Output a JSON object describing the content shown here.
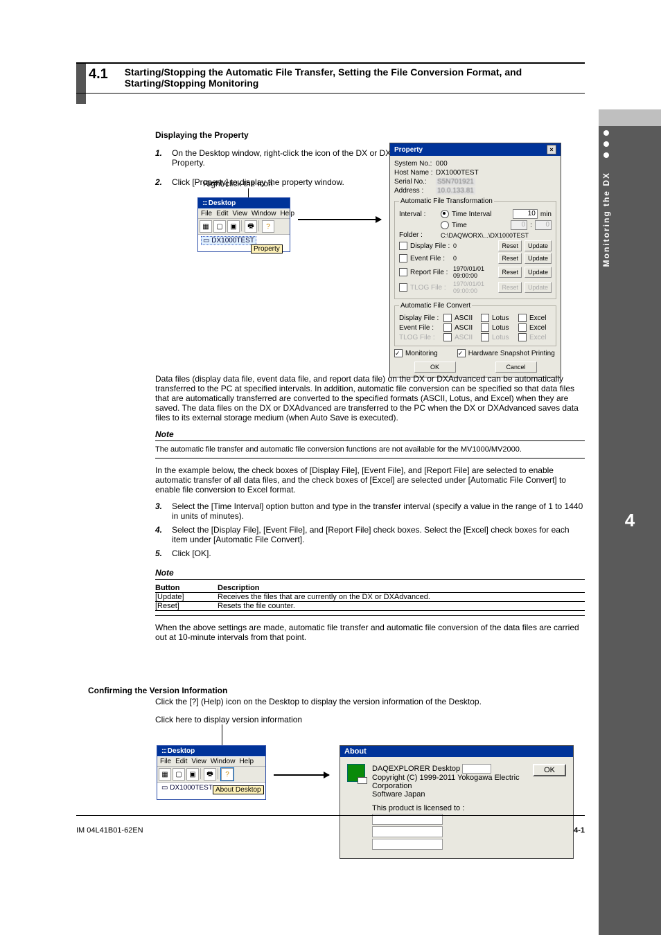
{
  "rightTab": {
    "num": "4",
    "label": "Monitoring the DX"
  },
  "section": {
    "number": "4.1",
    "title": "Starting/Stopping the Automatic File Transfer, Setting the File Conversion Format, and Starting/Stopping Monitoring"
  },
  "subsection": {
    "title": "Displaying the Property"
  },
  "steps": {
    "s1": "On the Desktop window, right-click the icon of the DX or DXAdvanced you wish to monitor to display the Property.",
    "s2": "Click [Property] to display the property window."
  },
  "callouts": {
    "rightclick": "Right-click the icon",
    "help": "Click here to display version information"
  },
  "desktop": {
    "title": "Desktop",
    "menus": [
      "File",
      "Edit",
      "View",
      "Window",
      "Help"
    ],
    "device": "DX1000TEST",
    "tooltip_prop": "Property",
    "tooltip_about": "About Desktop"
  },
  "property": {
    "title": "Property",
    "rows": {
      "systemno": {
        "label": "System No.:",
        "value": "000"
      },
      "hostname": {
        "label": "Host Name :",
        "value": "DX1000TEST"
      },
      "serial": {
        "label": "Serial No.:",
        "value": "S5N701921"
      },
      "address": {
        "label": "Address :",
        "value": "10.0.133.81"
      }
    },
    "aft": {
      "legend": "Automatic File Transformation",
      "intervalLabel": "Interval :",
      "opt_time_interval": "Time Interval",
      "opt_time": "Time",
      "time_interval_value": "10",
      "time_interval_unit": "min",
      "time_h": "0",
      "time_m": "0",
      "folderLabel": "Folder :",
      "folderVal": "C:\\DAQWORX\\...\\DX1000TEST",
      "filerows": [
        {
          "label": "Display File :",
          "value": "0",
          "reset": "Reset",
          "update": "Update",
          "en": true
        },
        {
          "label": "Event File :",
          "value": "0",
          "reset": "Reset",
          "update": "Update",
          "en": true
        },
        {
          "label": "Report File :",
          "value": "1970/01/01 09:00:00",
          "reset": "Reset",
          "update": "Update",
          "en": true
        },
        {
          "label": "TLOG File :",
          "value": "1970/01/01 09:00:00",
          "reset": "Reset",
          "update": "Update",
          "en": false
        }
      ]
    },
    "afc": {
      "legend": "Automatic File Convert",
      "rows": [
        {
          "label": "Display File :",
          "en": true
        },
        {
          "label": "Event File :",
          "en": true
        },
        {
          "label": "TLOG File :",
          "en": false
        }
      ],
      "fmt": {
        "ascii": "ASCII",
        "lotus": "Lotus",
        "excel": "Excel"
      }
    },
    "monitoring": "Monitoring",
    "hwprint": "Hardware Snapshot Printing",
    "ok": "OK",
    "cancel": "Cancel"
  },
  "explain": {
    "para1": "Data files (display data file, event data file, and report data file) on the DX or DXAdvanced can be automatically transferred to the PC at specified intervals. In addition, automatic file conversion can be specified so that data files that are automatically transferred are converted to the specified formats (ASCII, Lotus, and Excel) when they are saved. The data files on the DX or DXAdvanced are transferred to the PC when the DX or DXAdvanced saves data files to its external storage medium (when Auto Save is executed).",
    "notelabel": "Note",
    "note1": "The automatic file transfer and automatic file conversion functions are not available for the MV1000/MV2000.",
    "intro2": "In the example below, the check boxes of [Display File], [Event File], and [Report File] are selected to enable automatic transfer of all data files, and the check boxes of [Excel] are selected under [Automatic File Convert] to enable file conversion to Excel format.",
    "st3": "Select the [Time Interval] option button and type in the transfer interval (specify a value in the range of 1 to 1440 in units of minutes).",
    "st4": "Select the [Display File], [Event File], and [Report File] check boxes. Select the [Excel] check boxes for each item under [Automatic File Convert].",
    "st5": "Click [OK].",
    "notelabel2": "Note",
    "table": {
      "head": [
        "Button",
        "Description"
      ],
      "row_update": [
        "[Update]",
        "Receives the files that are currently on the DX or DXAdvanced."
      ],
      "row_reset": [
        "[Reset]",
        "Resets the file counter."
      ]
    },
    "after": "When the above settings are made, automatic file transfer and automatic file conversion of the data files are carried out at 10-minute intervals from that point."
  },
  "version": {
    "heading": "Confirming the Version Information",
    "body": "Click the [?] (Help) icon on the Desktop to display the version information of the Desktop."
  },
  "about": {
    "title": "About",
    "product": "DAQEXPLORER Desktop",
    "copyright": "Copyright (C) 1999-2011 Yokogawa Electric Corporation",
    "sw": "Software Japan",
    "lic": "This product is licensed to :",
    "ok": "OK"
  },
  "footer": {
    "left": "IM 04L41B01-62EN",
    "right": "4-1"
  }
}
